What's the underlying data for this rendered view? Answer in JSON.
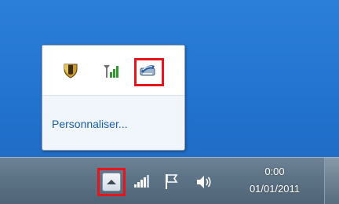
{
  "popup": {
    "customize_label": "Personnaliser...",
    "icons": [
      "security-shield-icon",
      "mobile-network-signal-icon",
      "device-app-icon"
    ]
  },
  "taskbar": {
    "show_hidden_icons": "chevron-up-icon",
    "tray_icons": [
      "network-signal-icon",
      "action-center-flag-icon",
      "speaker-volume-icon"
    ],
    "clock": {
      "time": "0:00",
      "date": "01/01/2011"
    }
  },
  "highlight_color": "#e8141c"
}
